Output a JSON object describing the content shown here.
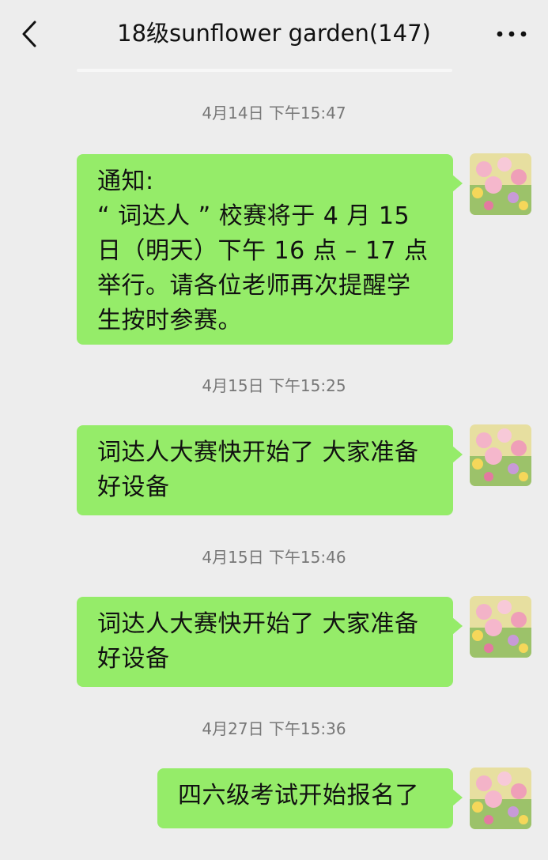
{
  "header": {
    "title": "18级sunflower garden(147)",
    "back_icon": "chevron-left-icon",
    "more_icon": "more-dots-icon"
  },
  "colors": {
    "background": "#ededed",
    "bubble": "#95ec69",
    "timestamp_text": "#777777"
  },
  "messages": [
    {
      "time": "4月14日 下午15:47",
      "lines": [
        "通知:",
        "“ 词达人 ” 校赛将于 4 月 15",
        "日（明天）下午 16 点 – 17 点",
        "举行。请各位老师再次提醒学",
        "生按时参赛。"
      ]
    },
    {
      "time": "4月15日 下午15:25",
      "lines": [
        "词达人大赛快开始了 大家准备",
        "好设备"
      ]
    },
    {
      "time": "4月15日 下午15:46",
      "lines": [
        "词达人大赛快开始了 大家准备",
        "好设备"
      ]
    },
    {
      "time": "4月27日 下午15:36",
      "lines": [
        "四六级考试开始报名了"
      ]
    }
  ]
}
